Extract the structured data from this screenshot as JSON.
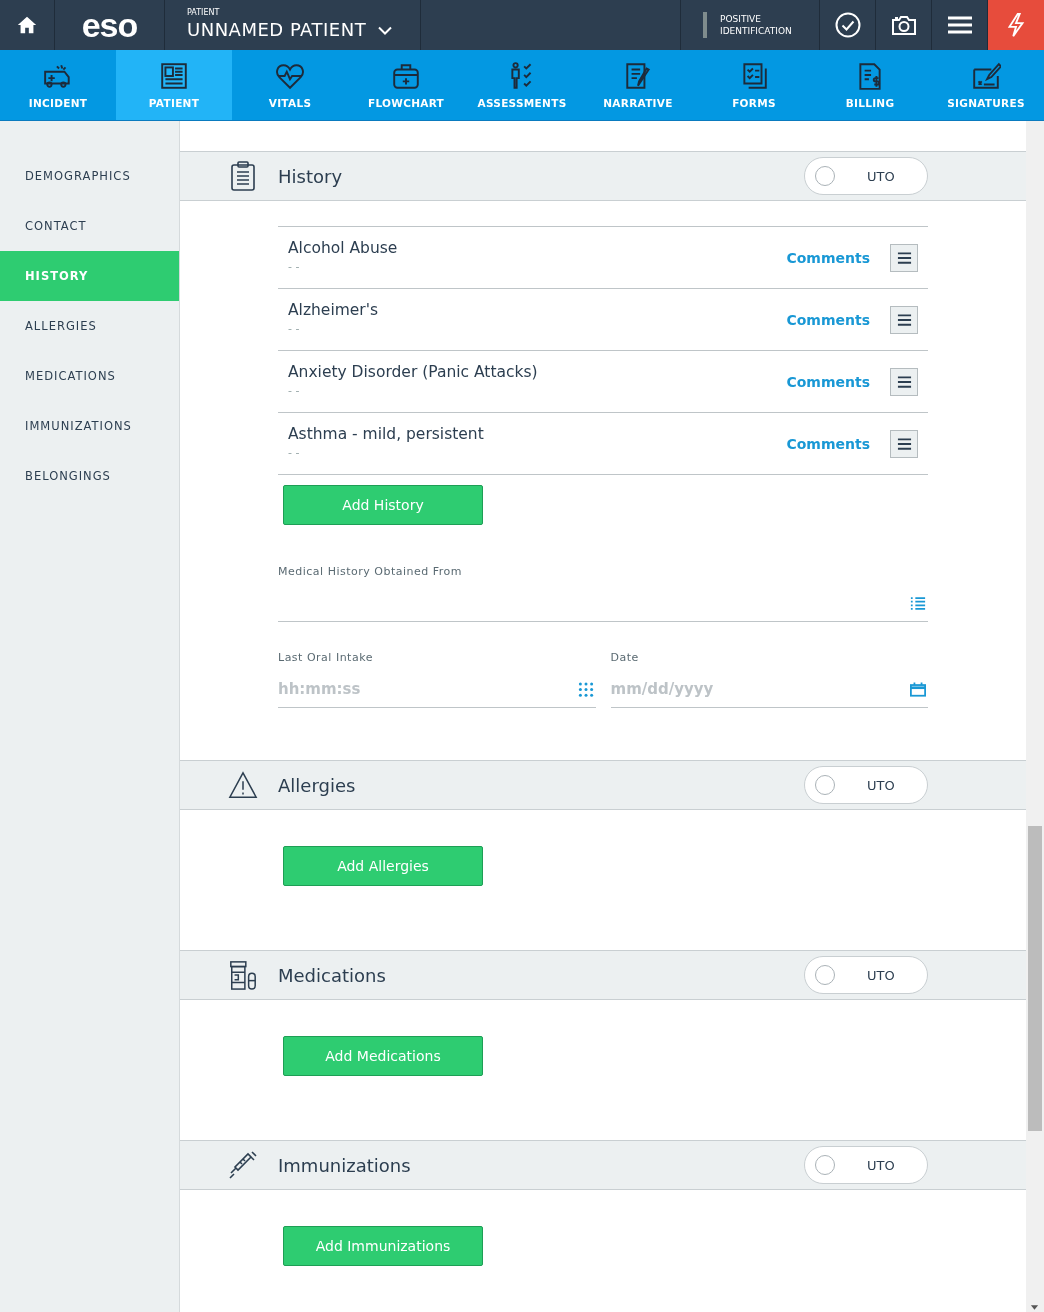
{
  "top_bar": {
    "logo": "eso",
    "patient_label": "PATIENT",
    "patient_name": "UNNAMED PATIENT",
    "identification": "POSITIVE IDENTIFICATION"
  },
  "nav_tabs": [
    {
      "label": "INCIDENT",
      "selected": false
    },
    {
      "label": "PATIENT",
      "selected": true
    },
    {
      "label": "VITALS",
      "selected": false
    },
    {
      "label": "FLOWCHART",
      "selected": false
    },
    {
      "label": "ASSESSMENTS",
      "selected": false
    },
    {
      "label": "NARRATIVE",
      "selected": false
    },
    {
      "label": "FORMS",
      "selected": false
    },
    {
      "label": "BILLING",
      "selected": false
    },
    {
      "label": "SIGNATURES",
      "selected": false
    }
  ],
  "sidebar": {
    "items": [
      {
        "label": "DEMOGRAPHICS",
        "selected": false
      },
      {
        "label": "CONTACT",
        "selected": false
      },
      {
        "label": "HISTORY",
        "selected": true
      },
      {
        "label": "ALLERGIES",
        "selected": false
      },
      {
        "label": "MEDICATIONS",
        "selected": false
      },
      {
        "label": "IMMUNIZATIONS",
        "selected": false
      },
      {
        "label": "BELONGINGS",
        "selected": false
      }
    ]
  },
  "sections": [
    {
      "title": "History",
      "uto": {
        "label": "UTO",
        "on": false
      },
      "items": [
        {
          "name": "Alcohol Abuse",
          "detail": "- -",
          "link": "Comments"
        },
        {
          "name": "Alzheimer's",
          "detail": "- -",
          "link": "Comments"
        },
        {
          "name": "Anxiety Disorder (Panic Attacks)",
          "detail": "- -",
          "link": "Comments"
        },
        {
          "name": "Asthma - mild, persistent",
          "detail": "- -",
          "link": "Comments"
        }
      ],
      "button": "Add History",
      "fields": [
        {
          "kind": "list",
          "label": "Medical History Obtained From"
        },
        {
          "kind": "time",
          "label": "Last Oral Intake",
          "placeholder": "hh:mm:ss"
        },
        {
          "kind": "date",
          "label": "Date",
          "placeholder": "mm/dd/yyyy"
        }
      ]
    },
    {
      "title": "Allergies",
      "uto": {
        "label": "UTO",
        "on": false
      },
      "button": "Add Allergies"
    },
    {
      "title": "Medications",
      "uto": {
        "label": "UTO",
        "on": false
      },
      "button": "Add Medications"
    },
    {
      "title": "Immunizations",
      "uto": {
        "label": "UTO",
        "on": false
      },
      "button": "Add Immunizations"
    }
  ]
}
